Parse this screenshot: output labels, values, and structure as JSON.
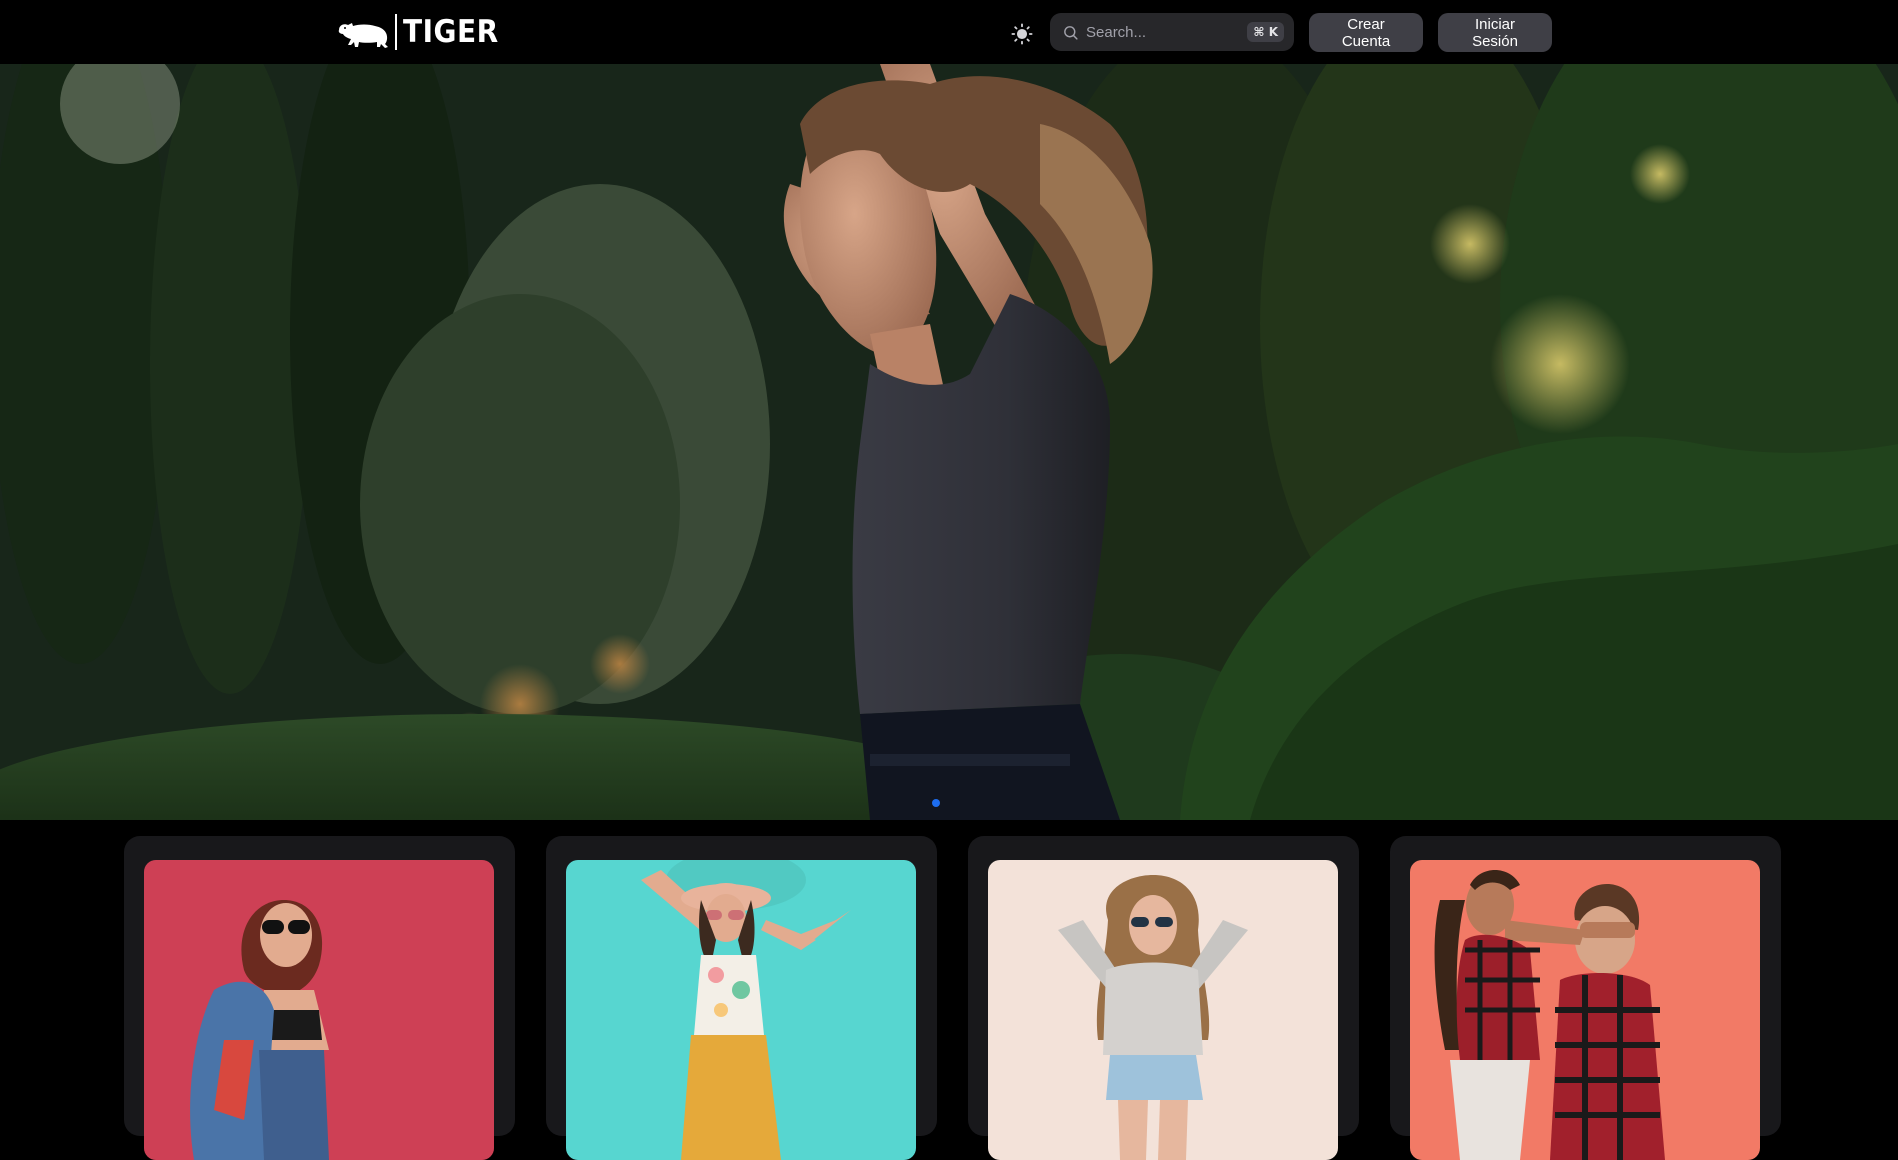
{
  "brand": {
    "name": "TIGER",
    "logo_icon": "tiger-icon"
  },
  "header": {
    "theme_toggle_icon": "sun-icon",
    "search": {
      "placeholder": "Search...",
      "shortcut": "⌘ K",
      "icon": "search-icon"
    },
    "signup_label": "Crear Cuenta",
    "login_label": "Iniciar Sesión"
  },
  "hero": {
    "slides_visible": 1,
    "active_slide_color": "#1d6df0"
  },
  "cards": [
    {
      "background": "#c83a50"
    },
    {
      "background": "#57d6d0"
    },
    {
      "background": "#f3e2d9"
    },
    {
      "background": "#f27a66"
    }
  ]
}
